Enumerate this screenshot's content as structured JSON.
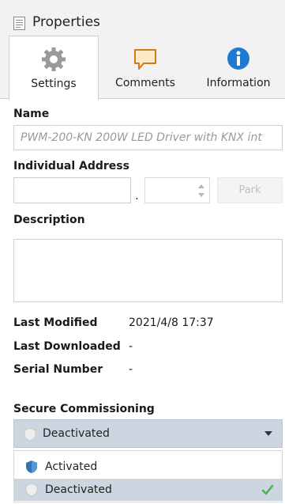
{
  "panel": {
    "title": "Properties",
    "icon": "properties-icon"
  },
  "tabs": [
    {
      "label": "Settings",
      "icon": "gear-icon",
      "active": true
    },
    {
      "label": "Comments",
      "icon": "comment-icon",
      "active": false
    },
    {
      "label": "Information",
      "icon": "info-icon",
      "active": false
    }
  ],
  "fields": {
    "name_label": "Name",
    "name_value": "PWM-200-KN 200W LED Driver with KNX int",
    "address_label": "Individual Address",
    "address_part1": "",
    "address_separator": ".",
    "address_part2": "",
    "park_label": "Park",
    "description_label": "Description",
    "description_value": ""
  },
  "info": {
    "last_modified_label": "Last Modified",
    "last_modified_value": "2021/4/8 17:37",
    "last_downloaded_label": "Last Downloaded",
    "last_downloaded_value": "-",
    "serial_number_label": "Serial Number",
    "serial_number_value": "-"
  },
  "secure": {
    "label": "Secure Commissioning",
    "selected": "Deactivated",
    "options": [
      {
        "label": "Activated",
        "icon": "shield-active-icon",
        "selected": false
      },
      {
        "label": "Deactivated",
        "icon": "shield-inactive-icon",
        "selected": true
      }
    ]
  },
  "colors": {
    "selection": "#cbd6e1",
    "check": "#4caf50",
    "shield_active": "#2f75b5"
  }
}
